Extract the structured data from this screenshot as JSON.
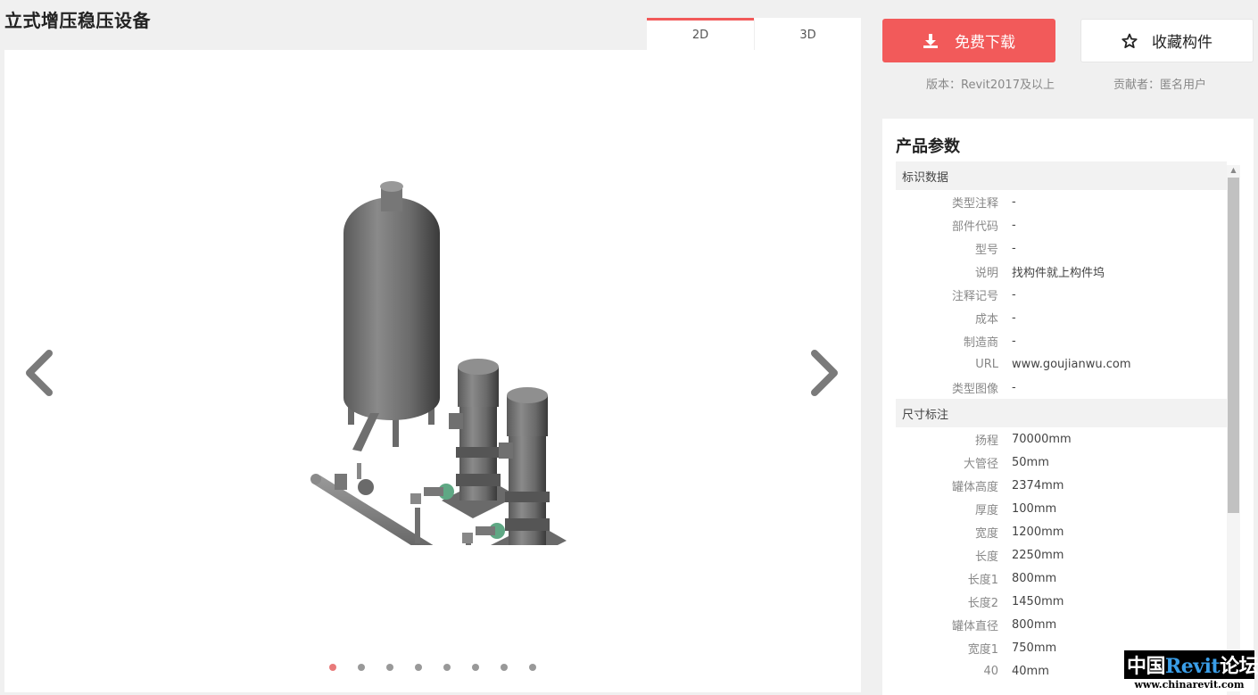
{
  "page": {
    "title": "立式增压稳压设备"
  },
  "view_tabs": [
    {
      "label": "2D",
      "active": true
    },
    {
      "label": "3D",
      "active": false
    }
  ],
  "carousel": {
    "dot_count": 8,
    "active_index": 0
  },
  "actions": {
    "download_label": "免费下载",
    "favorite_label": "收藏构件",
    "version_text": "版本：Revit2017及以上",
    "contributor_text": "贡献者：匿名用户",
    "accent_color": "#f25a5a"
  },
  "params": {
    "title": "产品参数",
    "sections": [
      {
        "heading": "标识数据",
        "rows": [
          {
            "label": "类型注释",
            "value": "-"
          },
          {
            "label": "部件代码",
            "value": "-"
          },
          {
            "label": "型号",
            "value": "-"
          },
          {
            "label": "说明",
            "value": "找构件就上构件坞"
          },
          {
            "label": "注释记号",
            "value": "-"
          },
          {
            "label": "成本",
            "value": "-"
          },
          {
            "label": "制造商",
            "value": "-"
          },
          {
            "label": "URL",
            "value": "www.goujianwu.com"
          },
          {
            "label": "类型图像",
            "value": "-"
          }
        ]
      },
      {
        "heading": "尺寸标注",
        "rows": [
          {
            "label": "扬程",
            "value": "70000mm"
          },
          {
            "label": "大管径",
            "value": "50mm"
          },
          {
            "label": "罐体高度",
            "value": "2374mm"
          },
          {
            "label": "厚度",
            "value": "100mm"
          },
          {
            "label": "宽度",
            "value": "1200mm"
          },
          {
            "label": "长度",
            "value": "2250mm"
          },
          {
            "label": "长度1",
            "value": "800mm"
          },
          {
            "label": "长度2",
            "value": "1450mm"
          },
          {
            "label": "罐体直径",
            "value": "800mm"
          },
          {
            "label": "宽度1",
            "value": "750mm"
          },
          {
            "label": "40",
            "value": "40mm"
          }
        ]
      }
    ]
  },
  "watermark": {
    "prefix": "中国",
    "accent": "Revit",
    "suffix": "论坛",
    "url": "www.chinarevit.com"
  }
}
